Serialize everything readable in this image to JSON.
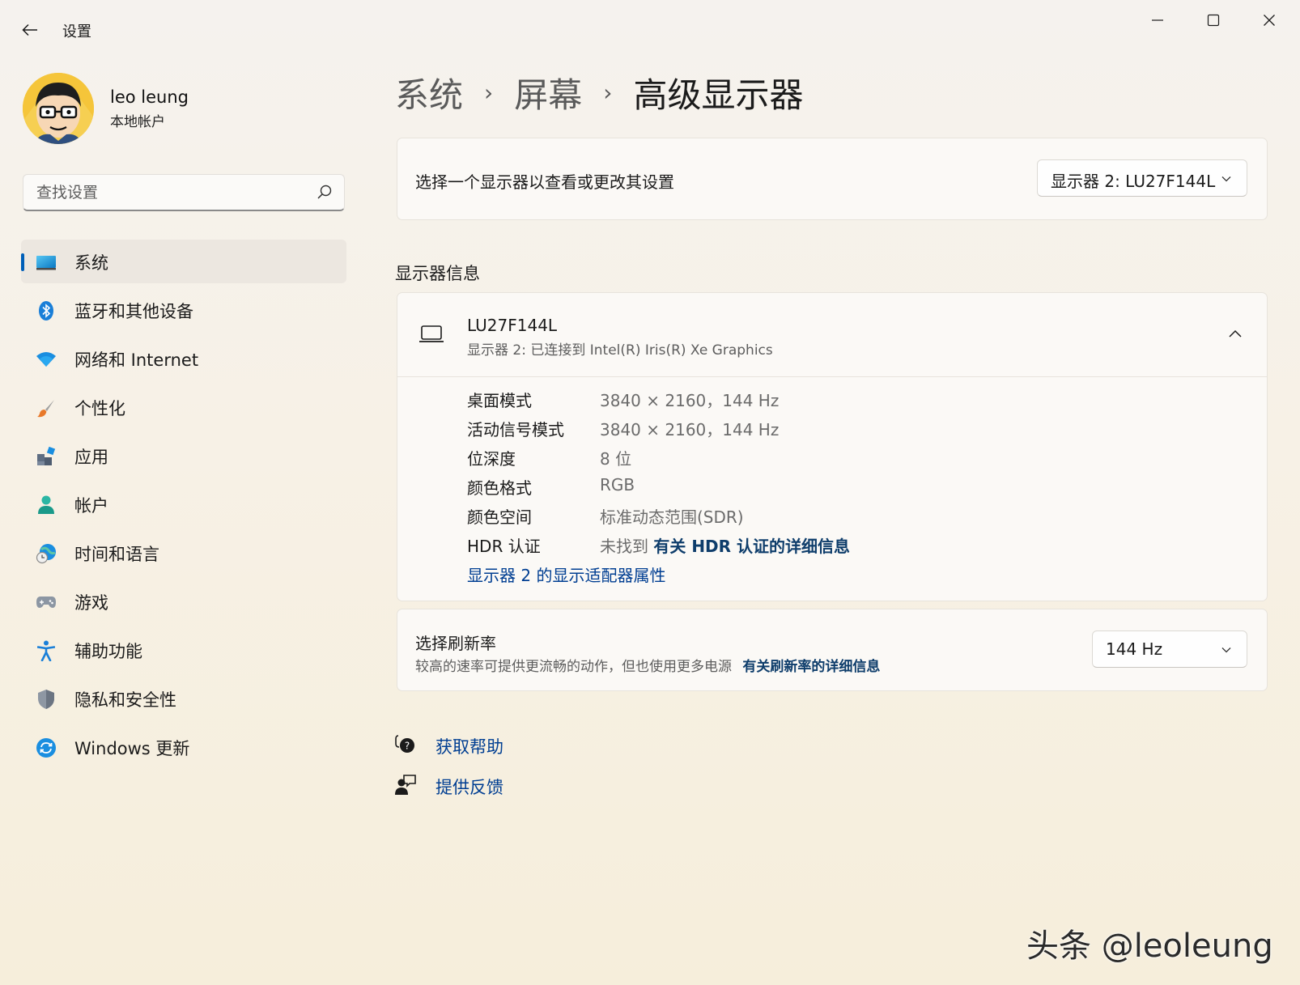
{
  "window": {
    "title": "设置"
  },
  "profile": {
    "name": "leo leung",
    "account_type": "本地帐户"
  },
  "search": {
    "placeholder": "查找设置"
  },
  "sidebar": {
    "items": [
      {
        "label": "系统",
        "icon": "display-icon",
        "active": true
      },
      {
        "label": "蓝牙和其他设备",
        "icon": "bluetooth-icon"
      },
      {
        "label": "网络和 Internet",
        "icon": "wifi-icon"
      },
      {
        "label": "个性化",
        "icon": "brush-icon"
      },
      {
        "label": "应用",
        "icon": "apps-icon"
      },
      {
        "label": "帐户",
        "icon": "person-icon"
      },
      {
        "label": "时间和语言",
        "icon": "globe-clock-icon"
      },
      {
        "label": "游戏",
        "icon": "gamepad-icon"
      },
      {
        "label": "辅助功能",
        "icon": "accessibility-icon"
      },
      {
        "label": "隐私和安全性",
        "icon": "shield-icon"
      },
      {
        "label": "Windows 更新",
        "icon": "update-icon"
      }
    ]
  },
  "breadcrumb": {
    "items": [
      "系统",
      "屏幕"
    ],
    "current": "高级显示器"
  },
  "display_select": {
    "label": "选择一个显示器以查看或更改其设置",
    "selected": "显示器 2: LU27F144L"
  },
  "display_info": {
    "section_title": "显示器信息",
    "monitor_name": "LU27F144L",
    "monitor_connection": "显示器 2: 已连接到 Intel(R) Iris(R) Xe Graphics",
    "rows": [
      {
        "key": "桌面模式",
        "value": "3840 × 2160，144 Hz"
      },
      {
        "key": "活动信号模式",
        "value": "3840 × 2160，144 Hz"
      },
      {
        "key": "位深度",
        "value": "8 位"
      },
      {
        "key": "颜色格式",
        "value": "RGB"
      },
      {
        "key": "颜色空间",
        "value": "标准动态范围(SDR)"
      },
      {
        "key": "HDR 认证",
        "value": "未找到",
        "link": "有关 HDR 认证的详细信息"
      }
    ],
    "adapter_link": "显示器 2 的显示适配器属性"
  },
  "refresh_rate": {
    "title": "选择刷新率",
    "description": "较高的速率可提供更流畅的动作，但也使用更多电源",
    "link": "有关刷新率的详细信息",
    "selected": "144 Hz"
  },
  "help": {
    "get_help": "获取帮助",
    "feedback": "提供反馈"
  },
  "watermark": "头条 @leoleung",
  "colors": {
    "accent": "#005fb8",
    "link": "#003e92"
  }
}
